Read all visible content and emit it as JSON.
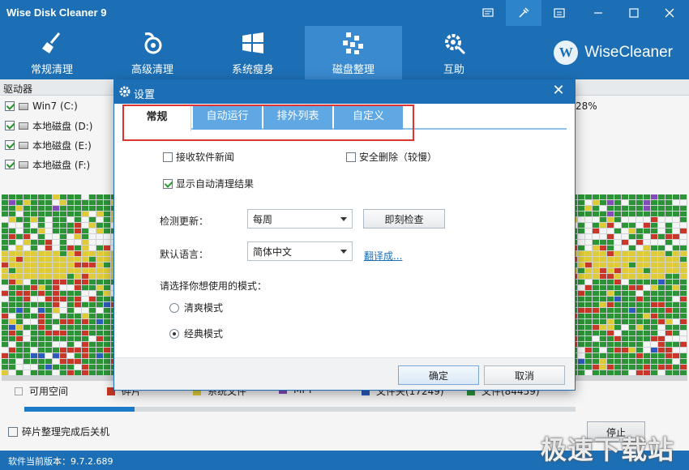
{
  "window": {
    "title": "Wise Disk Cleaner 9"
  },
  "toolbar": {
    "items": [
      {
        "label": "常规清理",
        "icon": "broom-icon"
      },
      {
        "label": "高级清理",
        "icon": "vacuum-icon"
      },
      {
        "label": "系统瘦身",
        "icon": "windows-icon"
      },
      {
        "label": "磁盘整理",
        "icon": "defrag-icon"
      },
      {
        "label": "互助",
        "icon": "gear-wrench-icon"
      }
    ],
    "active_index": 3,
    "brand": "WiseCleaner",
    "brand_logo_letter": "W"
  },
  "drives": {
    "header": "驱动器",
    "items": [
      {
        "label": "Win7 (C:)",
        "checked": true
      },
      {
        "label": "本地磁盘 (D:)",
        "checked": true
      },
      {
        "label": "本地磁盘 (E:)",
        "checked": true
      },
      {
        "label": "本地磁盘 (F:)",
        "checked": true
      }
    ],
    "c_percent_visible": "28%"
  },
  "legend": [
    {
      "label": "可用空间",
      "color": "#ffffff"
    },
    {
      "label": "碎片",
      "color": "#d23a2a"
    },
    {
      "label": "系统文件",
      "color": "#e8d43a"
    },
    {
      "label": "MFT",
      "color": "#8a4fc1"
    },
    {
      "label": "文件夹(17249)",
      "color": "#2f5fc4"
    },
    {
      "label": "文件(84459)",
      "color": "#2e9a3a"
    }
  ],
  "progress": {
    "value": 0.2
  },
  "bottom": {
    "shutdown_label": "碎片整理完成后关机",
    "stop_label": "停止",
    "version": "软件当前版本：9.7.2.689",
    "watermark": "极速下载站"
  },
  "dialog": {
    "title": "设置",
    "tabs": [
      "常规",
      "自动运行",
      "排外列表",
      "自定义"
    ],
    "active_tab": 0,
    "options": {
      "receive_news": {
        "label": "接收软件新闻",
        "checked": false
      },
      "secure_delete": {
        "label": "安全删除（较慢）",
        "checked": false
      },
      "show_results": {
        "label": "显示自动清理结果",
        "checked": true
      }
    },
    "update": {
      "label": "检测更新：",
      "value": "每周",
      "check_now": "即刻检查"
    },
    "language": {
      "label": "默认语言：",
      "value": "简体中文",
      "translate": "翻译成..."
    },
    "mode": {
      "label": "请选择你想使用的模式：",
      "options": [
        {
          "label": "清爽模式",
          "selected": false
        },
        {
          "label": "经典模式",
          "selected": true
        }
      ]
    },
    "ok_label": "确定",
    "cancel_label": "取消"
  }
}
